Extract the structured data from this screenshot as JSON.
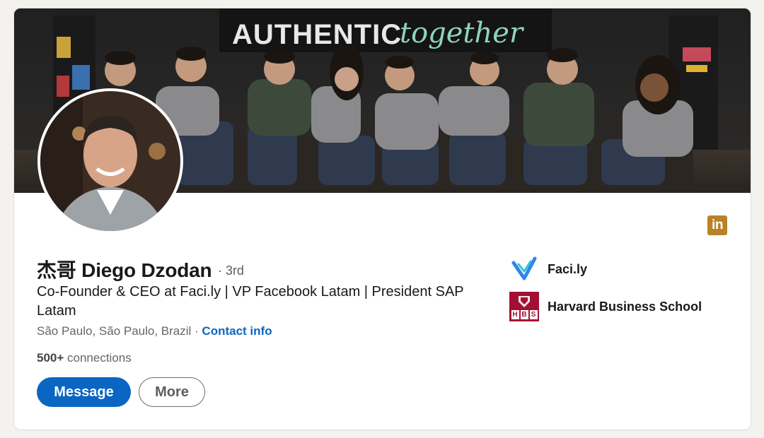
{
  "cover": {
    "banner_text_left": "AUTHENTIC",
    "banner_text_right": "together"
  },
  "profile": {
    "name": "杰哥 Diego Dzodan",
    "degree": "· 3rd",
    "headline": "Co-Founder & CEO at Faci.ly | VP Facebook Latam | President SAP Latam",
    "location": "São Paulo, São Paulo, Brazil",
    "separator": " · ",
    "contact_label": "Contact info",
    "connections_count": "500+",
    "connections_label": " connections"
  },
  "actions": {
    "message_label": "Message",
    "more_label": "More"
  },
  "organizations": [
    {
      "name": "Faci.ly",
      "icon": "faci-logo-icon"
    },
    {
      "name": "Harvard Business School",
      "icon": "hbs-logo-icon",
      "logo_letters": [
        "H",
        "B",
        "S"
      ]
    }
  ],
  "badge": {
    "text": "in",
    "icon": "linkedin-icon"
  },
  "colors": {
    "accent": "#0a66c2",
    "linkedin_badge": "#b9822a",
    "hbs_crimson": "#a41034"
  }
}
